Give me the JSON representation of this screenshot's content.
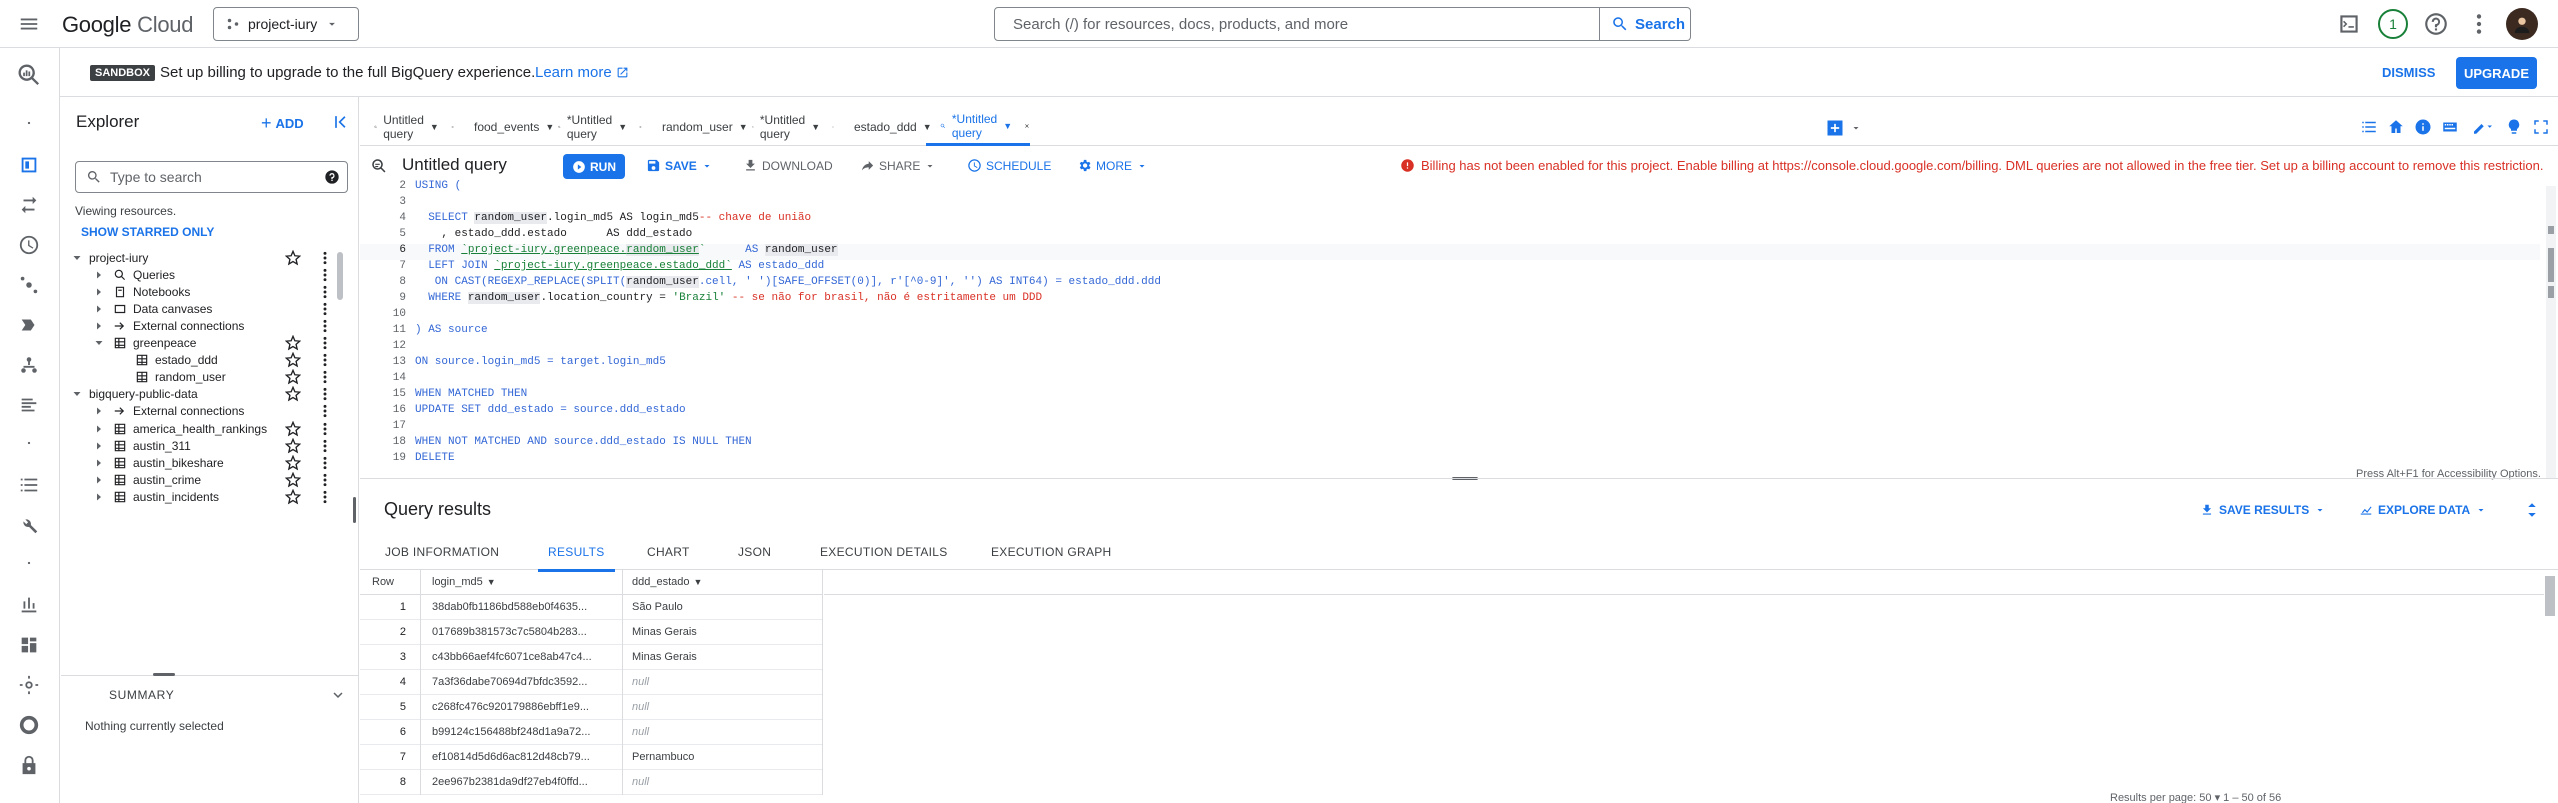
{
  "header": {
    "logo_google": "Google",
    "logo_cloud": "Cloud",
    "project": "project-iury",
    "search_placeholder": "Search (/) for resources, docs, products, and more",
    "search_button": "Search",
    "notifications_count": "1"
  },
  "banner": {
    "badge": "SANDBOX",
    "text": "Set up billing to upgrade to the full BigQuery experience.",
    "link": "Learn more",
    "dismiss": "DISMISS",
    "upgrade": "UPGRADE"
  },
  "explorer": {
    "title": "Explorer",
    "add": "ADD",
    "search_placeholder": "Type to search",
    "viewing": "Viewing resources.",
    "show_starred": "SHOW STARRED ONLY",
    "tree": [
      {
        "label": "project-iury",
        "level": 0
      },
      {
        "label": "Queries",
        "level": 1
      },
      {
        "label": "Notebooks",
        "level": 1
      },
      {
        "label": "Data canvases",
        "level": 1
      },
      {
        "label": "External connections",
        "level": 1
      },
      {
        "label": "greenpeace",
        "level": 1
      },
      {
        "label": "estado_ddd",
        "level": 2
      },
      {
        "label": "random_user",
        "level": 2
      },
      {
        "label": "bigquery-public-data",
        "level": 0
      },
      {
        "label": "External connections",
        "level": 1
      },
      {
        "label": "america_health_rankings",
        "level": 1
      },
      {
        "label": "austin_311",
        "level": 1
      },
      {
        "label": "austin_bikeshare",
        "level": 1
      },
      {
        "label": "austin_crime",
        "level": 1
      },
      {
        "label": "austin_incidents",
        "level": 1
      }
    ],
    "summary": "SUMMARY",
    "nothing_selected": "Nothing currently selected"
  },
  "tabs": [
    {
      "label": "Untitled query"
    },
    {
      "label": "food_events"
    },
    {
      "label": "*Untitled query"
    },
    {
      "label": "random_user"
    },
    {
      "label": "*Untitled query"
    },
    {
      "label": "estado_ddd"
    },
    {
      "label": "*Untitled query"
    }
  ],
  "editor": {
    "title": "Untitled query",
    "run": "RUN",
    "save": "SAVE",
    "download": "DOWNLOAD",
    "share": "SHARE",
    "schedule": "SCHEDULE",
    "more": "MORE",
    "error": "Billing has not been enabled for this project. Enable billing at https://console.cloud.google.com/billing. DML queries are not allowed in the free tier. Set up a billing account to remove this restriction.",
    "accessibility": "Press Alt+F1 for Accessibility Options.",
    "line_numbers": [
      "2",
      "3",
      "4",
      "5",
      "6",
      "7",
      "8",
      "9",
      "10",
      "11",
      "12",
      "13",
      "14",
      "15",
      "16",
      "17",
      "18",
      "19"
    ],
    "code": {
      "l2": "USING (",
      "l4a": "  SELECT ",
      "l4b": "random_user",
      "l4c": ".login_md5 AS login_md5",
      "l4d": "-- chave de união",
      "l5": "    , estado_ddd.estado      AS ddd_estado",
      "l6a": "  FROM ",
      "l6b": "`project-iury.greenpeace.",
      "l6c": "random_user",
      "l6d": "`",
      "l6e": "      AS ",
      "l6f": "random_user",
      "l7a": "  LEFT JOIN ",
      "l7b": "`project-iury.greenpeace.estado_ddd`",
      "l7c": " AS estado_ddd",
      "l8a": "   ON CAST(REGEXP_REPLACE(SPLIT(",
      "l8b": "random_user",
      "l8c": ".cell, ' ')[SAFE_OFFSET(0)], r'[^0-9]', '') AS INT64) = estado_ddd.ddd",
      "l9a": "  WHERE ",
      "l9b": "random_user",
      "l9c": ".location_country = ",
      "l9d": "'Brazil'",
      "l9e": " -- se não for brasil, não é estritamente um DDD",
      "l11": ") AS source",
      "l13": "ON source.login_md5 = target.login_md5",
      "l15": "WHEN MATCHED THEN",
      "l16": "UPDATE SET ddd_estado = source.ddd_estado",
      "l18": "WHEN NOT MATCHED AND source.ddd_estado IS NULL THEN",
      "l19": "DELETE"
    }
  },
  "results": {
    "title": "Query results",
    "save_results": "SAVE RESULTS",
    "explore_data": "EXPLORE DATA",
    "tabs": [
      "JOB INFORMATION",
      "RESULTS",
      "CHART",
      "JSON",
      "EXECUTION DETAILS",
      "EXECUTION GRAPH"
    ],
    "columns": [
      "Row",
      "login_md5",
      "ddd_estado"
    ],
    "rows": [
      {
        "row": "1",
        "login_md5": "38dab0fb1186bd588eb0f4635...",
        "ddd_estado": "São Paulo"
      },
      {
        "row": "2",
        "login_md5": "017689b381573c7c5804b283...",
        "ddd_estado": "Minas Gerais"
      },
      {
        "row": "3",
        "login_md5": "c43bb66aef4fc6071ce8ab47c4...",
        "ddd_estado": "Minas Gerais"
      },
      {
        "row": "4",
        "login_md5": "7a3f36dabe70694d7bfdc3592...",
        "ddd_estado": "null"
      },
      {
        "row": "5",
        "login_md5": "c268fc476c920179886ebff1e9...",
        "ddd_estado": "null"
      },
      {
        "row": "6",
        "login_md5": "b99124c156488bf248d1a9a72...",
        "ddd_estado": "null"
      },
      {
        "row": "7",
        "login_md5": "ef10814d5d6d6ac812d48cb79...",
        "ddd_estado": "Pernambuco"
      },
      {
        "row": "8",
        "login_md5": "2ee967b2381da9df27eb4f0ffd...",
        "ddd_estado": "null"
      }
    ],
    "footer": "Results per page:   50  ▾     1 – 50 of 56"
  }
}
